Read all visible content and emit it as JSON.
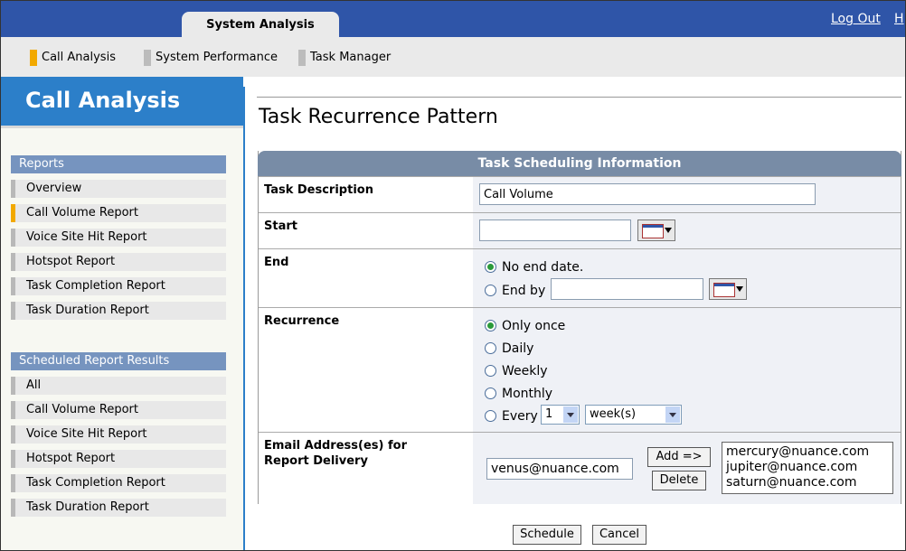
{
  "header": {
    "tab_label": "System Analysis",
    "logout": "Log Out",
    "help_partial": "H"
  },
  "subnav": {
    "items": [
      {
        "label": "Call Analysis",
        "active": true
      },
      {
        "label": "System Performance",
        "active": false
      },
      {
        "label": "Task Manager",
        "active": false
      }
    ]
  },
  "sidebar": {
    "title": "Call Analysis",
    "reports_header": "Reports",
    "reports": [
      "Overview",
      "Call Volume Report",
      "Voice Site Hit Report",
      "Hotspot Report",
      "Task Completion Report",
      "Task Duration Report"
    ],
    "active_report": "Call Volume Report",
    "scheduled_header": "Scheduled Report Results",
    "scheduled": [
      "All",
      "Call Volume Report",
      "Voice Site Hit Report",
      "Hotspot Report",
      "Task Completion Report",
      "Task Duration Report"
    ]
  },
  "main": {
    "title": "Task Recurrence Pattern",
    "panel_title": "Task Scheduling Information",
    "task_description": {
      "label": "Task Description",
      "value": "Call Volume"
    },
    "start": {
      "label": "Start",
      "value": ""
    },
    "end": {
      "label": "End",
      "no_end": "No end date.",
      "end_by": "End by",
      "value": "",
      "selected": "no_end"
    },
    "recurrence": {
      "label": "Recurrence",
      "options": [
        "Only once",
        "Daily",
        "Weekly",
        "Monthly"
      ],
      "every_label": "Every",
      "every_count": "1",
      "every_unit": "week(s)",
      "selected": "Only once"
    },
    "email": {
      "label_line1": "Email Address(es) for",
      "label_line2": "Report Delivery",
      "input_value": "venus@nuance.com",
      "add_label": "Add =>",
      "delete_label": "Delete",
      "list": [
        "mercury@nuance.com",
        "jupiter@nuance.com",
        "saturn@nuance.com"
      ]
    },
    "schedule_label": "Schedule",
    "cancel_label": "Cancel"
  },
  "colors": {
    "brand_blue": "#2f55a8",
    "sidebar_blue": "#2c7fc9",
    "accent_orange": "#f2a900",
    "panel_header": "#788ca6"
  }
}
